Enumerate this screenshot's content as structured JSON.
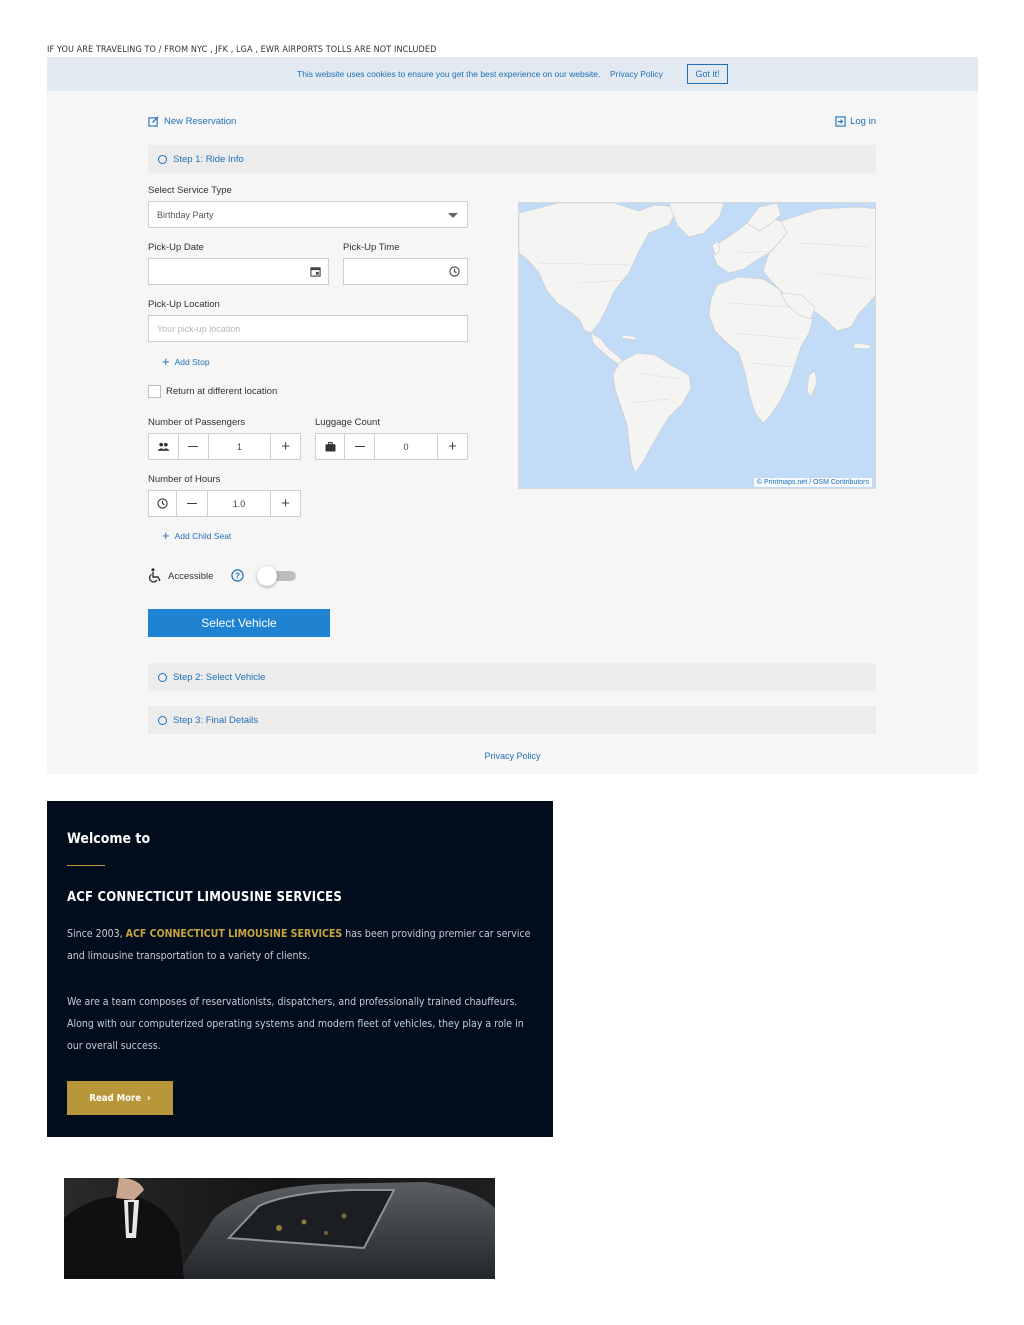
{
  "notice": "IF YOU ARE TRAVELING TO / FROM NYC , JFK , LGA , EWR AIRPORTS TOLLS ARE NOT INCLUDED",
  "cookie": {
    "text": "This website uses cookies to ensure you get the best experience on our website.",
    "link": "Privacy Policy",
    "button": "Got it!"
  },
  "header": {
    "new_reservation": "New Reservation",
    "login": "Log in"
  },
  "steps": {
    "step1": "Step 1: Ride Info",
    "step2": "Step 2: Select Vehicle",
    "step3": "Step 3: Final Details"
  },
  "form": {
    "service_type_label": "Select Service Type",
    "service_type_value": "Birthday Party",
    "pickup_date_label": "Pick-Up Date",
    "pickup_date_value": "",
    "pickup_time_label": "Pick-Up Time",
    "pickup_time_value": "",
    "pickup_location_label": "Pick-Up Location",
    "pickup_location_placeholder": "Your pick-up location",
    "add_stop": "Add Stop",
    "return_label": "Return at different location",
    "passengers_label": "Number of Passengers",
    "passengers_value": "1",
    "luggage_label": "Luggage Count",
    "luggage_value": "0",
    "hours_label": "Number of Hours",
    "hours_value": "1.0",
    "add_child_seat": "Add Child Seat",
    "accessible_label": "Accessible",
    "select_vehicle": "Select Vehicle"
  },
  "map": {
    "credit": "© Printmaps.net / OSM Contributors"
  },
  "footer_link": "Privacy Policy",
  "welcome": {
    "heading": "Welcome to",
    "title": "ACF CONNECTICUT LIMOUSINE SERVICES",
    "para1_prefix": "Since 2003,",
    "para1_brand": "ACF CONNECTICUT LIMOUSINE SERVICES",
    "para1_suffix": "has been providing premier car service and limousine transportation to a variety of clients.",
    "para2": "We are a team composes of reservationists, dispatchers, and professionally trained chauffeurs. Along with our computerized operating systems and modern fleet of vehicles, they play a role in our overall success.",
    "read_more": "Read More"
  },
  "colors": {
    "accent_blue": "#1f70b8",
    "button_blue": "#1f83d2",
    "dark_bg": "#010d1c",
    "gold": "#b8963a"
  }
}
